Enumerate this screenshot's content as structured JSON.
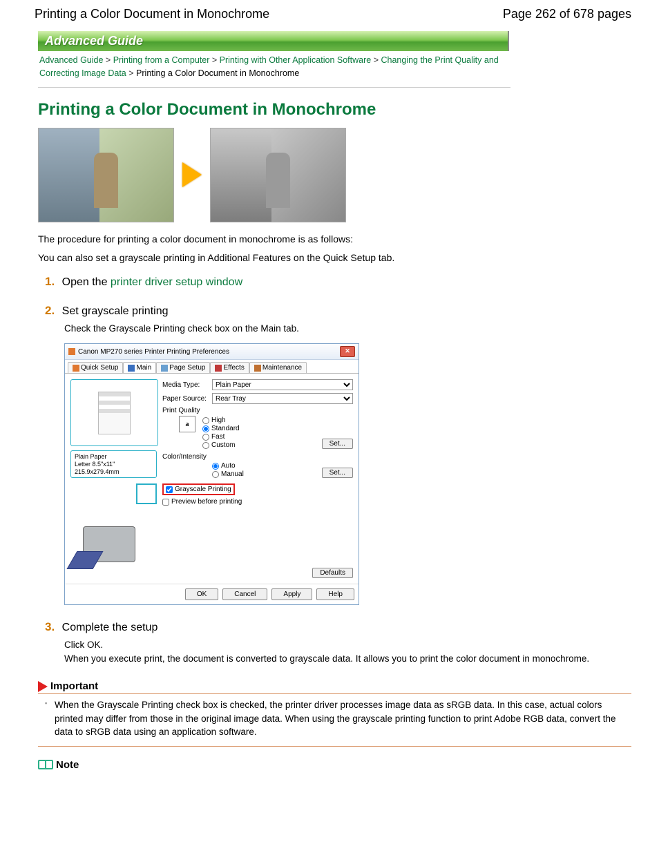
{
  "header": {
    "doc_title": "Printing a Color Document in Monochrome",
    "page_indicator": "Page 262 of 678 pages"
  },
  "banner": "Advanced Guide",
  "breadcrumb": {
    "items": [
      "Advanced Guide",
      "Printing from a Computer",
      "Printing with Other Application Software",
      "Changing the Print Quality and Correcting Image Data",
      "Printing a Color Document in Monochrome"
    ],
    "sep": ">"
  },
  "title": "Printing a Color Document in Monochrome",
  "intro": {
    "p1": "The procedure for printing a color document in monochrome is as follows:",
    "p2": "You can also set a grayscale printing in Additional Features on the Quick Setup tab."
  },
  "steps": {
    "s1": {
      "num": "1.",
      "pre": "Open the ",
      "link": "printer driver setup window"
    },
    "s2": {
      "num": "2.",
      "title": "Set grayscale printing",
      "body": "Check the Grayscale Printing check box on the Main tab."
    },
    "s3": {
      "num": "3.",
      "title": "Complete the setup",
      "b1": "Click OK.",
      "b2": "When you execute print, the document is converted to grayscale data. It allows you to print the color document in monochrome."
    }
  },
  "dialog": {
    "title": "Canon MP270 series Printer Printing Preferences",
    "tabs": [
      "Quick Setup",
      "Main",
      "Page Setup",
      "Effects",
      "Maintenance"
    ],
    "media_type_lbl": "Media Type:",
    "media_type_val": "Plain Paper",
    "paper_source_lbl": "Paper Source:",
    "paper_source_val": "Rear Tray",
    "print_quality_lbl": "Print Quality",
    "pq": {
      "high": "High",
      "standard": "Standard",
      "fast": "Fast",
      "custom": "Custom"
    },
    "set_btn": "Set...",
    "color_intensity_lbl": "Color/Intensity",
    "ci": {
      "auto": "Auto",
      "manual": "Manual"
    },
    "grayscale_chk": "Grayscale Printing",
    "preview_chk": "Preview before printing",
    "defaults_btn": "Defaults",
    "paper_info1": "Plain Paper",
    "paper_info2": "Letter 8.5\"x11\" 215.9x279.4mm",
    "ok": "OK",
    "cancel": "Cancel",
    "apply": "Apply",
    "help": "Help"
  },
  "important": {
    "label": "Important",
    "text": "When the Grayscale Printing check box is checked, the printer driver processes image data as sRGB data. In this case, actual colors printed may differ from those in the original image data. When using the grayscale printing function to print Adobe RGB data, convert the data to sRGB data using an application software."
  },
  "note": {
    "label": "Note"
  }
}
